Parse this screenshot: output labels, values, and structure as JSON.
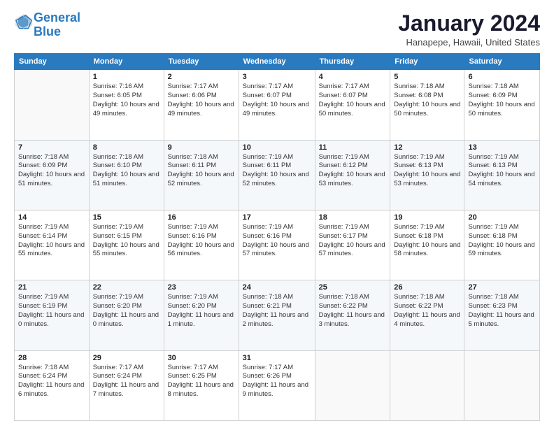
{
  "logo": {
    "line1": "General",
    "line2": "Blue"
  },
  "title": "January 2024",
  "location": "Hanapepe, Hawaii, United States",
  "headers": [
    "Sunday",
    "Monday",
    "Tuesday",
    "Wednesday",
    "Thursday",
    "Friday",
    "Saturday"
  ],
  "weeks": [
    [
      {
        "day": "",
        "sunrise": "",
        "sunset": "",
        "daylight": ""
      },
      {
        "day": "1",
        "sunrise": "Sunrise: 7:16 AM",
        "sunset": "Sunset: 6:05 PM",
        "daylight": "Daylight: 10 hours and 49 minutes."
      },
      {
        "day": "2",
        "sunrise": "Sunrise: 7:17 AM",
        "sunset": "Sunset: 6:06 PM",
        "daylight": "Daylight: 10 hours and 49 minutes."
      },
      {
        "day": "3",
        "sunrise": "Sunrise: 7:17 AM",
        "sunset": "Sunset: 6:07 PM",
        "daylight": "Daylight: 10 hours and 49 minutes."
      },
      {
        "day": "4",
        "sunrise": "Sunrise: 7:17 AM",
        "sunset": "Sunset: 6:07 PM",
        "daylight": "Daylight: 10 hours and 50 minutes."
      },
      {
        "day": "5",
        "sunrise": "Sunrise: 7:18 AM",
        "sunset": "Sunset: 6:08 PM",
        "daylight": "Daylight: 10 hours and 50 minutes."
      },
      {
        "day": "6",
        "sunrise": "Sunrise: 7:18 AM",
        "sunset": "Sunset: 6:09 PM",
        "daylight": "Daylight: 10 hours and 50 minutes."
      }
    ],
    [
      {
        "day": "7",
        "sunrise": "Sunrise: 7:18 AM",
        "sunset": "Sunset: 6:09 PM",
        "daylight": "Daylight: 10 hours and 51 minutes."
      },
      {
        "day": "8",
        "sunrise": "Sunrise: 7:18 AM",
        "sunset": "Sunset: 6:10 PM",
        "daylight": "Daylight: 10 hours and 51 minutes."
      },
      {
        "day": "9",
        "sunrise": "Sunrise: 7:18 AM",
        "sunset": "Sunset: 6:11 PM",
        "daylight": "Daylight: 10 hours and 52 minutes."
      },
      {
        "day": "10",
        "sunrise": "Sunrise: 7:19 AM",
        "sunset": "Sunset: 6:11 PM",
        "daylight": "Daylight: 10 hours and 52 minutes."
      },
      {
        "day": "11",
        "sunrise": "Sunrise: 7:19 AM",
        "sunset": "Sunset: 6:12 PM",
        "daylight": "Daylight: 10 hours and 53 minutes."
      },
      {
        "day": "12",
        "sunrise": "Sunrise: 7:19 AM",
        "sunset": "Sunset: 6:13 PM",
        "daylight": "Daylight: 10 hours and 53 minutes."
      },
      {
        "day": "13",
        "sunrise": "Sunrise: 7:19 AM",
        "sunset": "Sunset: 6:13 PM",
        "daylight": "Daylight: 10 hours and 54 minutes."
      }
    ],
    [
      {
        "day": "14",
        "sunrise": "Sunrise: 7:19 AM",
        "sunset": "Sunset: 6:14 PM",
        "daylight": "Daylight: 10 hours and 55 minutes."
      },
      {
        "day": "15",
        "sunrise": "Sunrise: 7:19 AM",
        "sunset": "Sunset: 6:15 PM",
        "daylight": "Daylight: 10 hours and 55 minutes."
      },
      {
        "day": "16",
        "sunrise": "Sunrise: 7:19 AM",
        "sunset": "Sunset: 6:16 PM",
        "daylight": "Daylight: 10 hours and 56 minutes."
      },
      {
        "day": "17",
        "sunrise": "Sunrise: 7:19 AM",
        "sunset": "Sunset: 6:16 PM",
        "daylight": "Daylight: 10 hours and 57 minutes."
      },
      {
        "day": "18",
        "sunrise": "Sunrise: 7:19 AM",
        "sunset": "Sunset: 6:17 PM",
        "daylight": "Daylight: 10 hours and 57 minutes."
      },
      {
        "day": "19",
        "sunrise": "Sunrise: 7:19 AM",
        "sunset": "Sunset: 6:18 PM",
        "daylight": "Daylight: 10 hours and 58 minutes."
      },
      {
        "day": "20",
        "sunrise": "Sunrise: 7:19 AM",
        "sunset": "Sunset: 6:18 PM",
        "daylight": "Daylight: 10 hours and 59 minutes."
      }
    ],
    [
      {
        "day": "21",
        "sunrise": "Sunrise: 7:19 AM",
        "sunset": "Sunset: 6:19 PM",
        "daylight": "Daylight: 11 hours and 0 minutes."
      },
      {
        "day": "22",
        "sunrise": "Sunrise: 7:19 AM",
        "sunset": "Sunset: 6:20 PM",
        "daylight": "Daylight: 11 hours and 0 minutes."
      },
      {
        "day": "23",
        "sunrise": "Sunrise: 7:19 AM",
        "sunset": "Sunset: 6:20 PM",
        "daylight": "Daylight: 11 hours and 1 minute."
      },
      {
        "day": "24",
        "sunrise": "Sunrise: 7:18 AM",
        "sunset": "Sunset: 6:21 PM",
        "daylight": "Daylight: 11 hours and 2 minutes."
      },
      {
        "day": "25",
        "sunrise": "Sunrise: 7:18 AM",
        "sunset": "Sunset: 6:22 PM",
        "daylight": "Daylight: 11 hours and 3 minutes."
      },
      {
        "day": "26",
        "sunrise": "Sunrise: 7:18 AM",
        "sunset": "Sunset: 6:22 PM",
        "daylight": "Daylight: 11 hours and 4 minutes."
      },
      {
        "day": "27",
        "sunrise": "Sunrise: 7:18 AM",
        "sunset": "Sunset: 6:23 PM",
        "daylight": "Daylight: 11 hours and 5 minutes."
      }
    ],
    [
      {
        "day": "28",
        "sunrise": "Sunrise: 7:18 AM",
        "sunset": "Sunset: 6:24 PM",
        "daylight": "Daylight: 11 hours and 6 minutes."
      },
      {
        "day": "29",
        "sunrise": "Sunrise: 7:17 AM",
        "sunset": "Sunset: 6:24 PM",
        "daylight": "Daylight: 11 hours and 7 minutes."
      },
      {
        "day": "30",
        "sunrise": "Sunrise: 7:17 AM",
        "sunset": "Sunset: 6:25 PM",
        "daylight": "Daylight: 11 hours and 8 minutes."
      },
      {
        "day": "31",
        "sunrise": "Sunrise: 7:17 AM",
        "sunset": "Sunset: 6:26 PM",
        "daylight": "Daylight: 11 hours and 9 minutes."
      },
      {
        "day": "",
        "sunrise": "",
        "sunset": "",
        "daylight": ""
      },
      {
        "day": "",
        "sunrise": "",
        "sunset": "",
        "daylight": ""
      },
      {
        "day": "",
        "sunrise": "",
        "sunset": "",
        "daylight": ""
      }
    ]
  ]
}
